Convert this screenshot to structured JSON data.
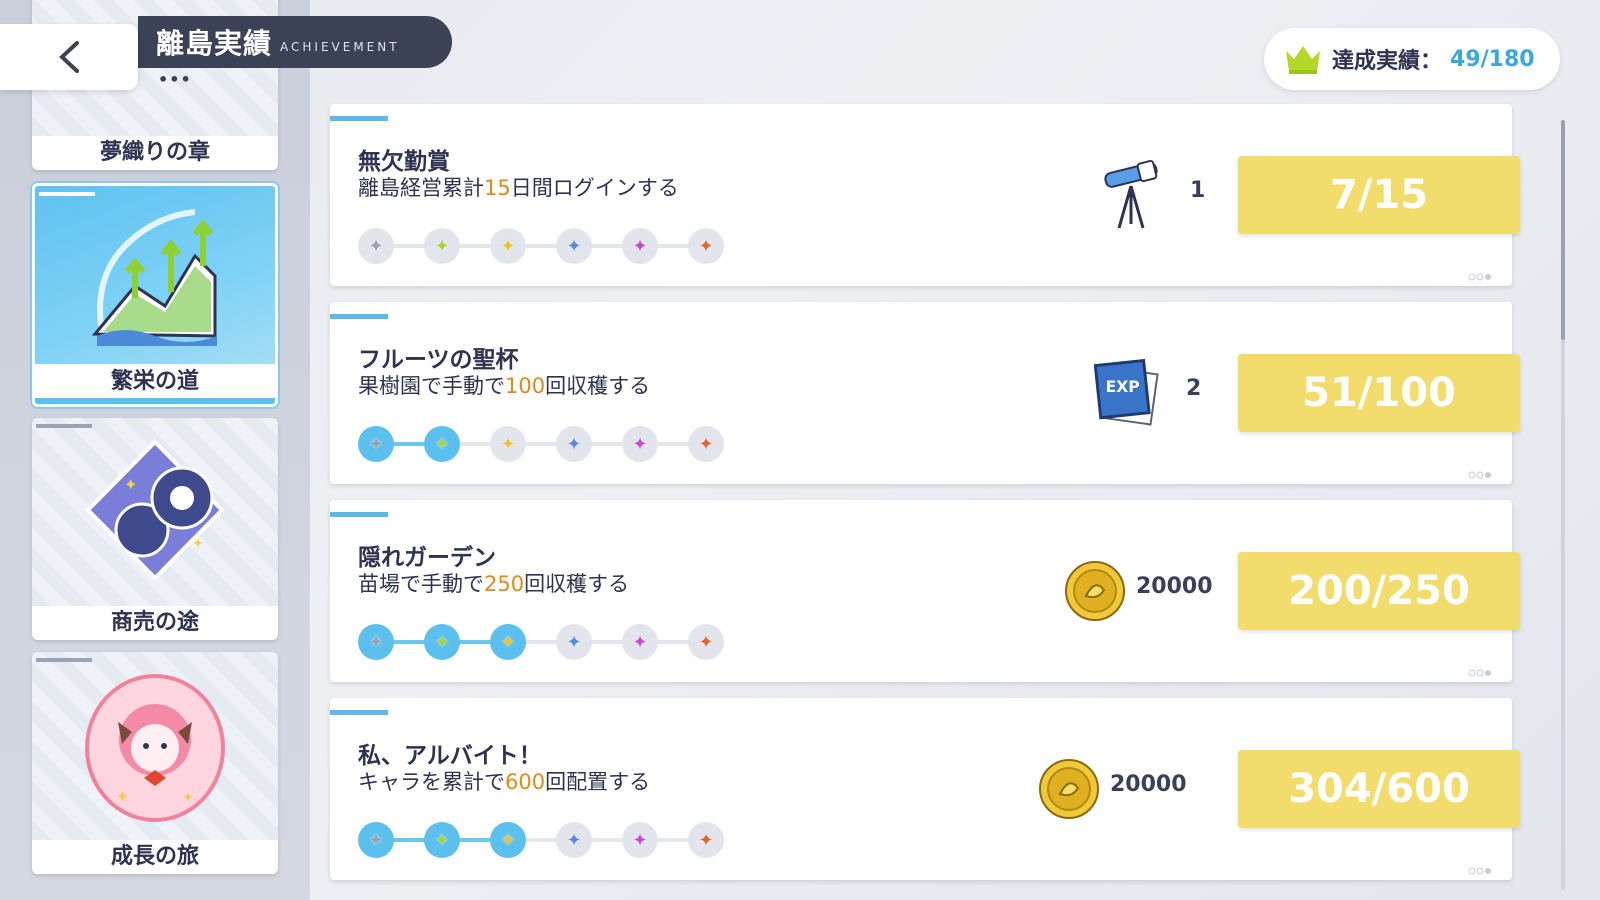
{
  "header": {
    "title": "離島実績",
    "subtitle": "ACHIEVEMENT",
    "dots": "•••"
  },
  "counter": {
    "label": "達成実績：",
    "value": "49/180",
    "icon": "crown-icon",
    "color": "#3ca6e0"
  },
  "categories": [
    {
      "label": "夢織りの章",
      "active": false
    },
    {
      "label": "繁栄の道",
      "active": true
    },
    {
      "label": "商売の途",
      "active": false
    },
    {
      "label": "成長の旅",
      "active": false
    }
  ],
  "achievements": [
    {
      "name": "無欠勤賞",
      "desc_pre": "離島経営累計",
      "desc_num": "15",
      "desc_post": "日間ログインする",
      "steps_done": 0,
      "reward_icon": "telescope-icon",
      "reward_qty": "1",
      "progress": "7/15"
    },
    {
      "name": "フルーツの聖杯",
      "desc_pre": "果樹園で手動で",
      "desc_num": "100",
      "desc_post": "回収穫する",
      "steps_done": 2,
      "reward_icon": "exp-book-icon",
      "reward_qty": "2",
      "progress": "51/100"
    },
    {
      "name": "隠れガーデン",
      "desc_pre": "苗場で手動で",
      "desc_num": "250",
      "desc_post": "回収穫する",
      "steps_done": 3,
      "reward_icon": "gold-coin-icon",
      "reward_qty": "20000",
      "progress": "200/250"
    },
    {
      "name": "私、アルバイト！",
      "desc_pre": "キャラを累計で",
      "desc_num": "600",
      "desc_post": "回配置する",
      "steps_done": 3,
      "reward_icon": "gold-coin-icon",
      "reward_qty": "20000",
      "progress": "304/600"
    }
  ],
  "colors": {
    "accent_blue": "#5cc0ee",
    "progress_yellow": "#f2dc6c",
    "number_orange": "#e08a1a",
    "dark_navy": "#3c4256"
  }
}
